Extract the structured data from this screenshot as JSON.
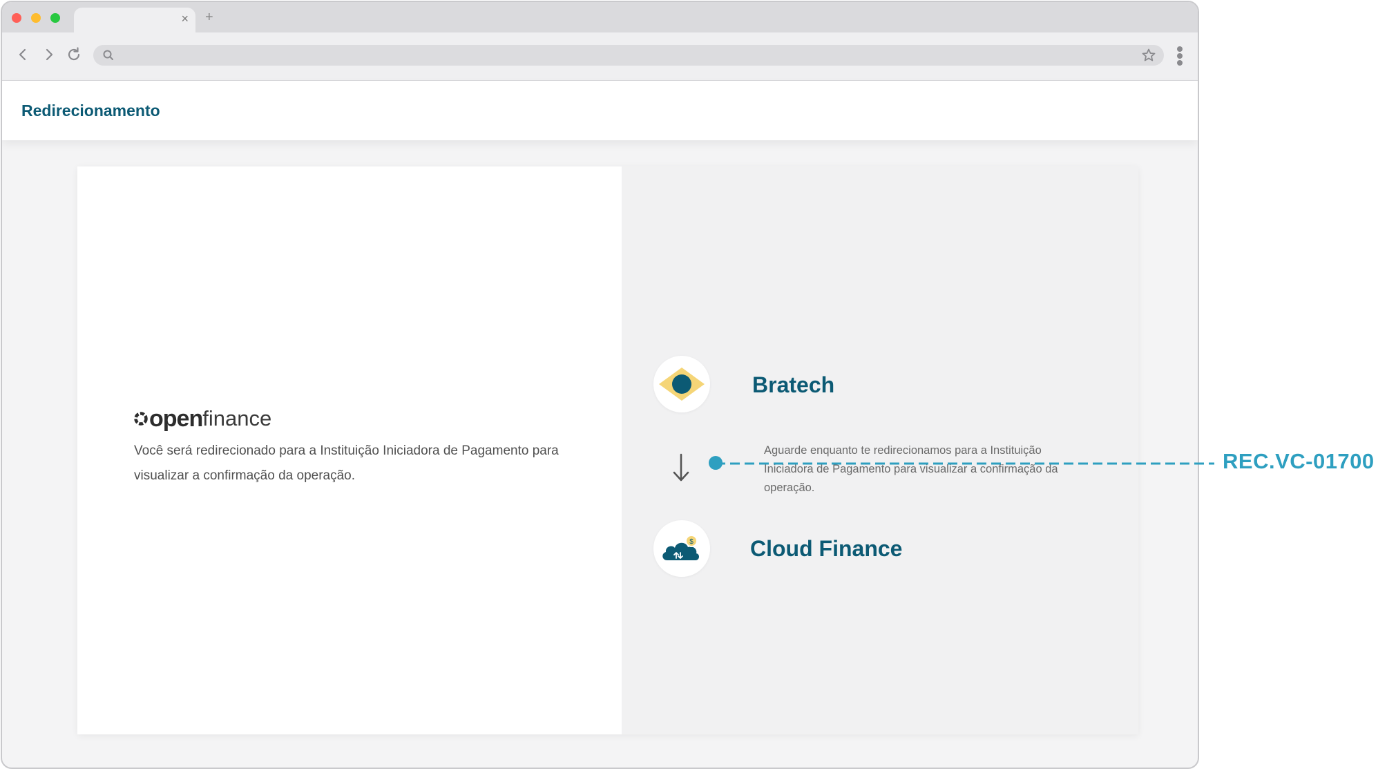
{
  "page": {
    "header_title": "Redirecionamento"
  },
  "left_panel": {
    "logo_open": "open",
    "logo_finance": "finance",
    "message": "Você será redirecionado para a Instituição Iniciadora de Pagamento para visualizar a confirmação da operação."
  },
  "right_panel": {
    "from_institution": {
      "name": "Bratech",
      "icon": "bratech-diamond-logo",
      "colors": {
        "diamond": "#f5d577",
        "circle": "#0c5a74"
      }
    },
    "redirect_message": "Aguarde enquanto te redirecionamos para a Instituição Iniciadora de Pagamento para visualizar a confirmação da operação.",
    "arrow_icon": "arrow-down-icon",
    "to_institution": {
      "name": "Cloud Finance",
      "icon": "cloud-finance-logo",
      "colors": {
        "cloud": "#0c5a74",
        "coin": "#f5d577"
      }
    }
  },
  "annotation": {
    "label": "REC.VC-01700",
    "color": "#2e9fc0"
  },
  "colors": {
    "brand": "#0c5a74",
    "panel_bg": "#f1f1f2",
    "annotation": "#2e9fc0"
  }
}
